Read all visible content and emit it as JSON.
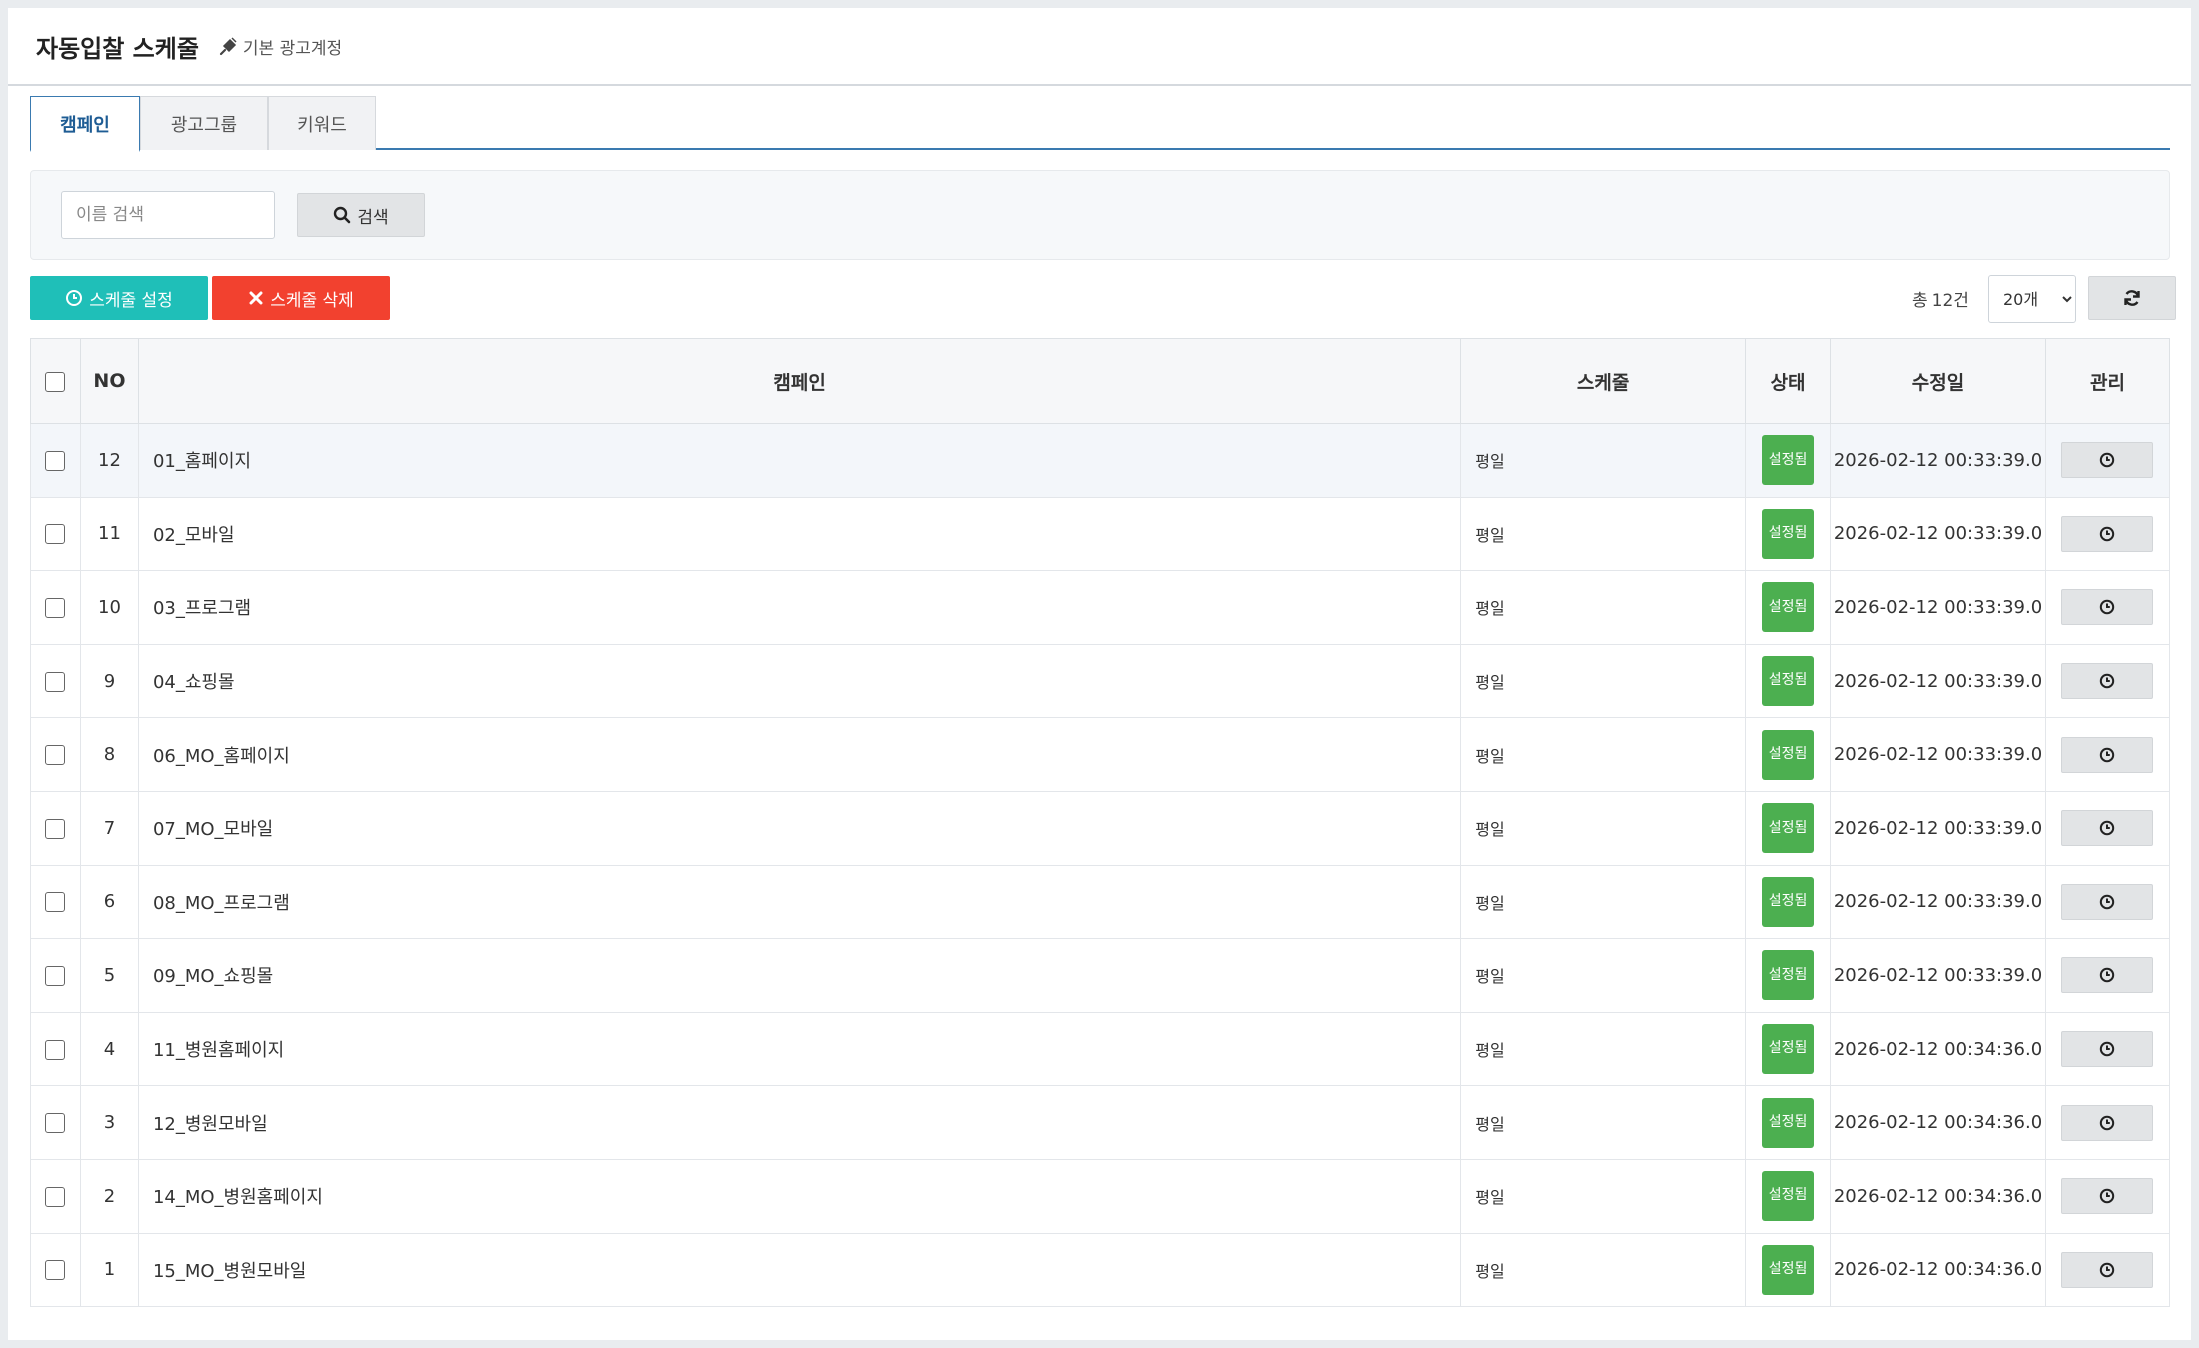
{
  "header": {
    "title": "자동입찰 스케줄",
    "account": "기본 광고계정"
  },
  "tabs": [
    {
      "label": "캠페인",
      "active": true
    },
    {
      "label": "광고그룹",
      "active": false
    },
    {
      "label": "키워드",
      "active": false
    }
  ],
  "search": {
    "placeholder": "이름 검색",
    "value": "",
    "button_label": "검색"
  },
  "toolbar": {
    "set_label": "스케줄 설정",
    "delete_label": "스케줄 삭제",
    "total_prefix": "총",
    "total_count": "12건",
    "per_page": "20개"
  },
  "table": {
    "headers": {
      "no": "NO",
      "name": "캠페인",
      "schedule": "스케줄",
      "status": "상태",
      "modified": "수정일",
      "manage": "관리"
    },
    "rows": [
      {
        "no": "12",
        "name": "01_홈페이지",
        "schedule": "평일",
        "status": "설정됨",
        "modified": "2026-02-12 00:33:39.0"
      },
      {
        "no": "11",
        "name": "02_모바일",
        "schedule": "평일",
        "status": "설정됨",
        "modified": "2026-02-12 00:33:39.0"
      },
      {
        "no": "10",
        "name": "03_프로그램",
        "schedule": "평일",
        "status": "설정됨",
        "modified": "2026-02-12 00:33:39.0"
      },
      {
        "no": "9",
        "name": "04_쇼핑몰",
        "schedule": "평일",
        "status": "설정됨",
        "modified": "2026-02-12 00:33:39.0"
      },
      {
        "no": "8",
        "name": "06_MO_홈페이지",
        "schedule": "평일",
        "status": "설정됨",
        "modified": "2026-02-12 00:33:39.0"
      },
      {
        "no": "7",
        "name": "07_MO_모바일",
        "schedule": "평일",
        "status": "설정됨",
        "modified": "2026-02-12 00:33:39.0"
      },
      {
        "no": "6",
        "name": "08_MO_프로그램",
        "schedule": "평일",
        "status": "설정됨",
        "modified": "2026-02-12 00:33:39.0"
      },
      {
        "no": "5",
        "name": "09_MO_쇼핑몰",
        "schedule": "평일",
        "status": "설정됨",
        "modified": "2026-02-12 00:33:39.0"
      },
      {
        "no": "4",
        "name": "11_병원홈페이지",
        "schedule": "평일",
        "status": "설정됨",
        "modified": "2026-02-12 00:34:36.0"
      },
      {
        "no": "3",
        "name": "12_병원모바일",
        "schedule": "평일",
        "status": "설정됨",
        "modified": "2026-02-12 00:34:36.0"
      },
      {
        "no": "2",
        "name": "14_MO_병원홈페이지",
        "schedule": "평일",
        "status": "설정됨",
        "modified": "2026-02-12 00:34:36.0"
      },
      {
        "no": "1",
        "name": "15_MO_병원모바일",
        "schedule": "평일",
        "status": "설정됨",
        "modified": "2026-02-12 00:34:36.0"
      }
    ]
  },
  "icons": {
    "account": "plug-icon",
    "search": "search-icon",
    "set": "clock-icon",
    "delete": "close-icon",
    "refresh": "refresh-icon",
    "manage": "clock-icon"
  },
  "colors": {
    "teal": "#1fbfb8",
    "red": "#f2412f",
    "green": "#4caf50",
    "tab_accent": "#1e5c94"
  }
}
